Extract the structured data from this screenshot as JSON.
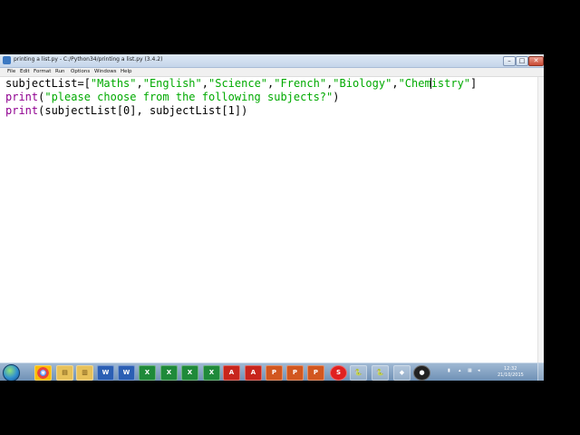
{
  "window": {
    "title": "printing a list.py - C:/Python34/printing a list.py (3.4.2)",
    "controls": {
      "minimize": "–",
      "maximize": "□",
      "close": "✕"
    }
  },
  "menu": {
    "items": [
      {
        "id": "file",
        "label": "File"
      },
      {
        "id": "edit",
        "label": "Edit"
      },
      {
        "id": "format",
        "label": "Format"
      },
      {
        "id": "run",
        "label": "Run"
      },
      {
        "id": "options",
        "label": "Options"
      },
      {
        "id": "windows",
        "label": "Windows"
      },
      {
        "id": "help",
        "label": "Help"
      }
    ]
  },
  "editor": {
    "line1": {
      "var": "subjectList=[",
      "s1": "\"Maths\"",
      "c1": ",",
      "s2": "\"English\"",
      "c2": ",",
      "s3": "\"Science\"",
      "c3": ",",
      "s4": "\"French\"",
      "c4": ",",
      "s5": "\"Biology\"",
      "c5": ",",
      "s6a": "\"Chem",
      "s6b": "istry\"",
      "end": "]"
    },
    "line2": {
      "kw": "print",
      "open": "(",
      "str": "\"please choose from the following subjects?\"",
      "close": ")"
    },
    "line3": {
      "kw": "print",
      "a": "(subjectList[0], subjectList[1",
      "b": "])"
    }
  },
  "taskbar": {
    "colors": {
      "word": "#2b5fb4",
      "excel": "#1f8a3a",
      "pdf": "#c8251c",
      "ppt": "#d2571f"
    },
    "icons": [
      {
        "id": "chrome",
        "icon": "chrome-icon",
        "glyph": "◉"
      },
      {
        "id": "explorer",
        "icon": "folder-icon",
        "glyph": "▤"
      },
      {
        "id": "library",
        "icon": "library-icon",
        "glyph": "▥"
      },
      {
        "id": "word1",
        "icon": "word-icon",
        "glyph": "W"
      },
      {
        "id": "word2",
        "icon": "word-icon",
        "glyph": "W"
      },
      {
        "id": "excel1",
        "icon": "excel-icon",
        "glyph": "X"
      },
      {
        "id": "excel2",
        "icon": "excel-icon",
        "glyph": "X"
      },
      {
        "id": "excel3",
        "icon": "excel-icon",
        "glyph": "X"
      },
      {
        "id": "excel4",
        "icon": "excel-icon",
        "glyph": "X"
      },
      {
        "id": "pdf1",
        "icon": "pdf-icon",
        "glyph": "A"
      },
      {
        "id": "pdf2",
        "icon": "pdf-icon",
        "glyph": "A"
      },
      {
        "id": "ppt1",
        "icon": "powerpoint-icon",
        "glyph": "P"
      },
      {
        "id": "ppt2",
        "icon": "powerpoint-icon",
        "glyph": "P"
      },
      {
        "id": "ppt3",
        "icon": "powerpoint-icon",
        "glyph": "P"
      },
      {
        "id": "scrapbook",
        "icon": "red-circle-app-icon",
        "glyph": "S"
      },
      {
        "id": "python1",
        "icon": "python-icon",
        "glyph": "🐍"
      },
      {
        "id": "python2",
        "icon": "python-icon",
        "glyph": "🐍"
      },
      {
        "id": "recorder",
        "icon": "screen-recorder-icon",
        "glyph": "◆"
      },
      {
        "id": "obs",
        "icon": "obs-icon",
        "glyph": "●"
      }
    ],
    "clock": {
      "time": "12:32",
      "date": "21/10/2015"
    }
  }
}
